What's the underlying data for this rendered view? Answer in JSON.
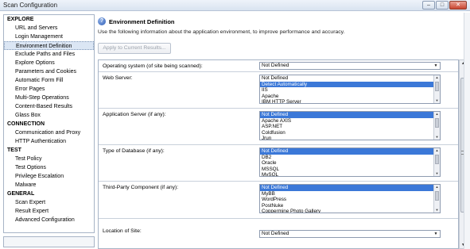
{
  "window": {
    "title": "Scan Configuration",
    "minimize_glyph": "–",
    "maximize_glyph": "□",
    "close_glyph": "✕"
  },
  "sidebar": {
    "groups": [
      {
        "label": "EXPLORE",
        "items": [
          "URL and Servers",
          "Login Management",
          "Environment Definition",
          "Exclude Paths and Files",
          "Explore Options",
          "Parameters and Cookies",
          "Automatic Form Fill",
          "Error Pages",
          "Multi-Step Operations",
          "Content-Based Results",
          "Glass Box"
        ]
      },
      {
        "label": "CONNECTION",
        "items": [
          "Communication and Proxy",
          "HTTP Authentication"
        ]
      },
      {
        "label": "TEST",
        "items": [
          "Test Policy",
          "Test Options",
          "Privilege Escalation",
          "Malware"
        ]
      },
      {
        "label": "GENERAL",
        "items": [
          "Scan Expert",
          "Result Expert",
          "Advanced Configuration"
        ]
      }
    ],
    "selected": "Environment Definition"
  },
  "header": {
    "icon": "help-circle-icon",
    "title": "Environment Definition",
    "description": "Use the following information about the application environment, to improve performance and accuracy.",
    "apply_label": "Apply to Current Results..."
  },
  "fields": {
    "os": {
      "label": "Operating system (of site being scanned):",
      "value": "Not Defined"
    },
    "web_server": {
      "label": "Web Server:",
      "options": [
        "Not Defined",
        "Detect Automatically",
        "IIS",
        "Apache",
        "IBM HTTP Server"
      ],
      "selected": 1
    },
    "app_server": {
      "label": "Application Server (if any):",
      "options": [
        "Not Defined",
        "Apache AXIS",
        "ASP.NET",
        "Coldfusion",
        "Jrun"
      ],
      "selected": 0
    },
    "database": {
      "label": "Type of Database (if any):",
      "options": [
        "Not Defined",
        "DB2",
        "Oracle",
        "MSSQL",
        "MySQL"
      ],
      "selected": 0
    },
    "third_party": {
      "label": "Third-Party Component (if any):",
      "options": [
        "Not Defined",
        "MyBB",
        "WordPress",
        "PostNuke",
        "Coppermine Photo Gallery"
      ],
      "selected": 0
    },
    "location": {
      "label": "Location of Site:",
      "value": "Not Defined"
    }
  },
  "glyphs": {
    "up": "▲",
    "down": "▼"
  }
}
